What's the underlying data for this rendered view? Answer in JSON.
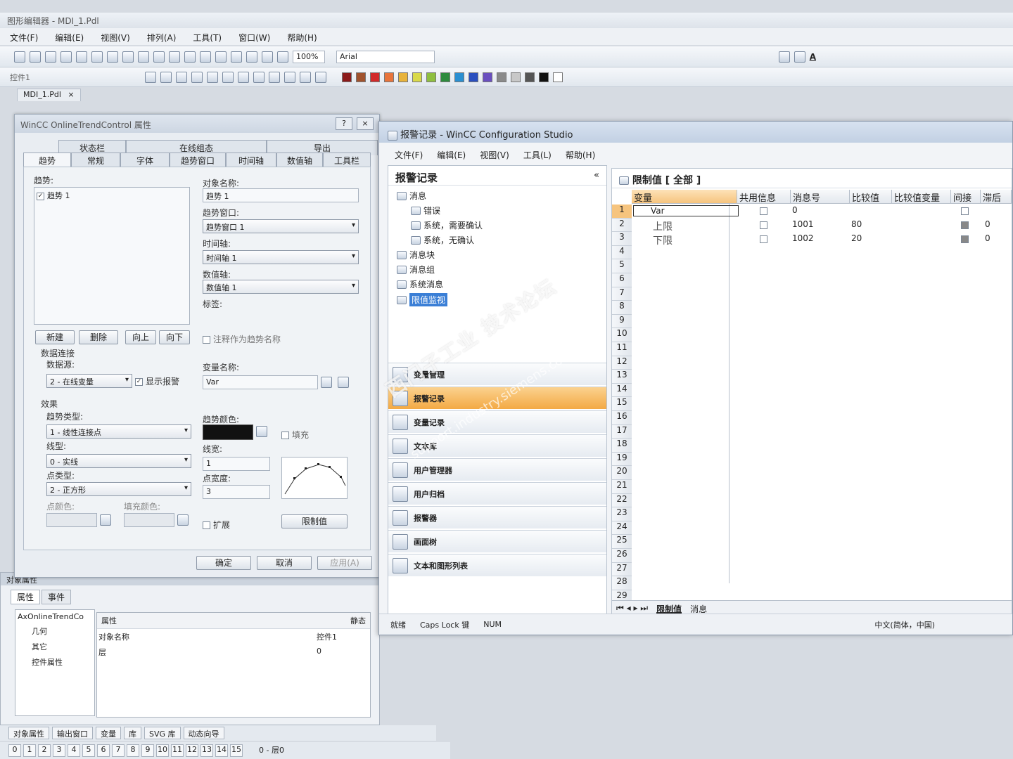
{
  "designer": {
    "title": "图形编辑器 - MDI_1.Pdl",
    "menu": [
      "文件(F)",
      "编辑(E)",
      "视图(V)",
      "排列(A)",
      "工具(T)",
      "窗口(W)",
      "帮助(H)"
    ],
    "zoom": "100%",
    "font": "Arial",
    "object_field": "控件1",
    "doc_tab": "MDI_1.Pdl",
    "doc_tab_close": "×",
    "palette": [
      "#8b1a1a",
      "#a0522d",
      "#d12a2a",
      "#e8743b",
      "#e8b33b",
      "#d9d94a",
      "#8fbf3f",
      "#2e8b3e",
      "#2a8fd1",
      "#2a4fbf",
      "#6a4fbf",
      "#8a8a8a",
      "#c8c8c8",
      "#555555",
      "#111111",
      "#ffffff"
    ]
  },
  "prop_dialog": {
    "title": "WinCC OnlineTrendControl 属性",
    "help_btn": "?",
    "close_btn": "×",
    "tabs_row1": [
      "状态栏",
      "在线组态",
      "导出"
    ],
    "tabs_row2": [
      "趋势",
      "常规",
      "字体",
      "趋势窗口",
      "时间轴",
      "数值轴",
      "工具栏"
    ],
    "trend_label": "趋势:",
    "trend_items": [
      "趋势 1"
    ],
    "object_name_label": "对象名称:",
    "object_name": "趋势 1",
    "trend_window_label": "趋势窗口:",
    "trend_window": "趋势窗口 1",
    "time_axis_label": "时间轴:",
    "time_axis": "时间轴 1",
    "value_axis_label": "数值轴:",
    "value_axis": "数值轴 1",
    "tag_label": "标签:",
    "btn_new": "新建",
    "btn_delete": "删除",
    "btn_up": "向上",
    "btn_down": "向下",
    "comment_as_name": "注释作为趋势名称",
    "data_connection": "数据连接",
    "data_source_label": "数据源:",
    "data_source": "2 - 在线变量",
    "show_alarm": "显示报警",
    "var_name_label": "变量名称:",
    "var_name": "Var",
    "effect": "效果",
    "trend_type_label": "趋势类型:",
    "trend_type": "1 - 线性连接点",
    "trend_color_label": "趋势颜色:",
    "fill": "填充",
    "line_type_label": "线型:",
    "line_type": "0 - 实线",
    "line_width_label": "线宽:",
    "line_width": "1",
    "point_type_label": "点类型:",
    "point_type": "2 - 正方形",
    "point_width_label": "点宽度:",
    "point_width": "3",
    "point_color_label": "点颜色:",
    "fill_color_label": "填充颜色:",
    "extend": "扩展",
    "limit_btn": "限制值",
    "ok": "确定",
    "cancel": "取消",
    "apply": "应用(A)"
  },
  "object_properties": {
    "title": "对象属性",
    "tabs": [
      "属性",
      "事件"
    ],
    "tree_root": "AxOnlineTrendCo",
    "tree_items": [
      "几何",
      "其它",
      "控件属性"
    ],
    "col_attr": "属性",
    "col_static": "静态",
    "rows": [
      {
        "name": "对象名称",
        "value": "控件1"
      },
      {
        "name": "层",
        "value": "0"
      }
    ]
  },
  "bottom_tabs": [
    "对象属性",
    "输出窗口",
    "变量",
    "库",
    "SVG 库",
    "动态向导"
  ],
  "layers": [
    "0",
    "1",
    "2",
    "3",
    "4",
    "5",
    "6",
    "7",
    "8",
    "9",
    "10",
    "11",
    "12",
    "13",
    "14",
    "15"
  ],
  "layer_status": "0 - 层0",
  "config_studio": {
    "title": "报警记录 - WinCC Configuration Studio",
    "menu": [
      "文件(F)",
      "编辑(E)",
      "视图(V)",
      "工具(L)",
      "帮助(H)"
    ],
    "nav_title": "报警记录",
    "nav_collapse": "«",
    "tree": [
      {
        "label": "消息",
        "indent": 0
      },
      {
        "label": "错误",
        "indent": 1
      },
      {
        "label": "系统，需要确认",
        "indent": 1
      },
      {
        "label": "系统，无确认",
        "indent": 1
      },
      {
        "label": "消息块",
        "indent": 0
      },
      {
        "label": "消息组",
        "indent": 0
      },
      {
        "label": "系统消息",
        "indent": 0
      },
      {
        "label": "限值监视",
        "indent": 0,
        "selected": true
      }
    ],
    "editors": [
      "变量管理",
      "报警记录",
      "变量记录",
      "文本库",
      "用户管理器",
      "用户归档",
      "报警器",
      "画面树",
      "文本和图形列表"
    ],
    "grid_title": "限制值 [ 全部 ]",
    "columns": [
      "变量",
      "共用信息",
      "消息号",
      "比较值",
      "比较值变量",
      "间接",
      "滞后"
    ],
    "rows": [
      {
        "num": "1",
        "var": "Var",
        "msg": "0",
        "cmp": "",
        "hys": ""
      },
      {
        "num": "2",
        "var": "上限",
        "msg": "1001",
        "cmp": "80",
        "hys": "0"
      },
      {
        "num": "3",
        "var": "下限",
        "msg": "1002",
        "cmp": "20",
        "hys": "0"
      }
    ],
    "row_count": 29,
    "sheet_tabs": [
      "限制值",
      "消息"
    ],
    "status": [
      "就绪",
      "Caps Lock 键",
      "NUM"
    ],
    "locale": "中文(简体，中国)"
  },
  "watermark": "西门子工业 技术论坛",
  "watermark_url": "support.industry.siemens.com/cs"
}
